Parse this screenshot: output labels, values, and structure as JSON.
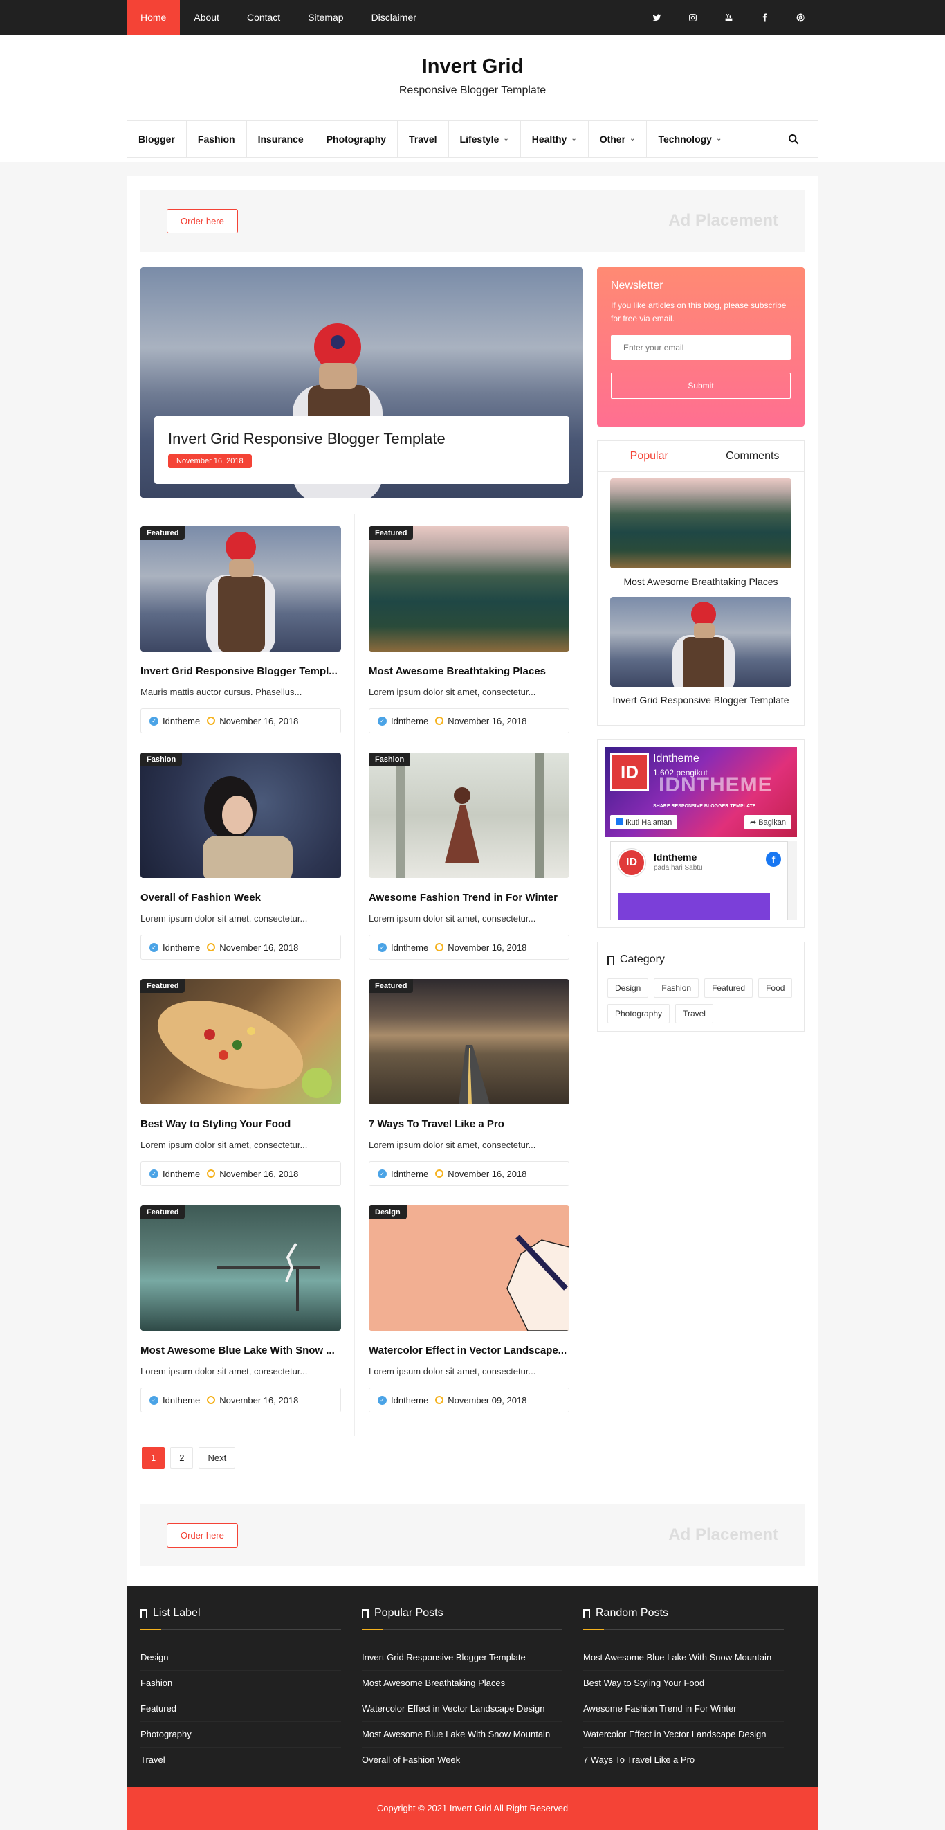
{
  "topbar": {
    "nav": [
      "Home",
      "About",
      "Contact",
      "Sitemap",
      "Disclaimer"
    ],
    "social": [
      "twitter-icon",
      "instagram-icon",
      "youtube-icon",
      "facebook-icon",
      "pinterest-icon"
    ]
  },
  "header": {
    "title": "Invert Grid",
    "subtitle": "Responsive Blogger Template"
  },
  "mainnav": {
    "items": [
      {
        "label": "Blogger",
        "dropdown": false
      },
      {
        "label": "Fashion",
        "dropdown": false
      },
      {
        "label": "Insurance",
        "dropdown": false
      },
      {
        "label": "Photography",
        "dropdown": false
      },
      {
        "label": "Travel",
        "dropdown": false
      },
      {
        "label": "Lifestyle",
        "dropdown": true
      },
      {
        "label": "Healthy",
        "dropdown": true
      },
      {
        "label": "Other",
        "dropdown": true
      },
      {
        "label": "Technology",
        "dropdown": true
      }
    ]
  },
  "ad": {
    "order_label": "Order here",
    "placement_label": "Ad Placement"
  },
  "hero": {
    "title": "Invert Grid Responsive Blogger Template",
    "date": "November 16, 2018"
  },
  "posts": [
    {
      "badge": "Featured",
      "title": "Invert Grid Responsive Blogger Templ...",
      "excerpt": "Mauris mattis auctor cursus. Phasellus...",
      "author": "Idntheme",
      "date": "November 16, 2018"
    },
    {
      "badge": "Featured",
      "title": "Most Awesome Breathtaking Places",
      "excerpt": "Lorem ipsum dolor sit amet, consectetur...",
      "author": "Idntheme",
      "date": "November 16, 2018"
    },
    {
      "badge": "Fashion",
      "title": "Overall of Fashion Week",
      "excerpt": "Lorem ipsum dolor sit amet, consectetur...",
      "author": "Idntheme",
      "date": "November 16, 2018"
    },
    {
      "badge": "Fashion",
      "title": "Awesome Fashion Trend in For Winter",
      "excerpt": "Lorem ipsum dolor sit amet, consectetur...",
      "author": "Idntheme",
      "date": "November 16, 2018"
    },
    {
      "badge": "Featured",
      "title": "Best Way to Styling Your Food",
      "excerpt": "Lorem ipsum dolor sit amet, consectetur...",
      "author": "Idntheme",
      "date": "November 16, 2018"
    },
    {
      "badge": "Featured",
      "title": "7 Ways To Travel Like a Pro",
      "excerpt": "Lorem ipsum dolor sit amet, consectetur...",
      "author": "Idntheme",
      "date": "November 16, 2018"
    },
    {
      "badge": "Featured",
      "title": "Most Awesome Blue Lake With Snow ...",
      "excerpt": "Lorem ipsum dolor sit amet, consectetur...",
      "author": "Idntheme",
      "date": "November 16, 2018"
    },
    {
      "badge": "Design",
      "title": "Watercolor Effect in Vector Landscape...",
      "excerpt": "Lorem ipsum dolor sit amet, consectetur...",
      "author": "Idntheme",
      "date": "November 09, 2018"
    }
  ],
  "pager": {
    "page1": "1",
    "page2": "2",
    "next": "Next"
  },
  "newsletter": {
    "title": "Newsletter",
    "text": "If you like articles on this blog, please subscribe for free via email.",
    "placeholder": "Enter your email",
    "submit": "Submit"
  },
  "tabs": {
    "popular": "Popular",
    "comments": "Comments",
    "items": [
      "Most Awesome Breathtaking Places",
      "Invert Grid Responsive Blogger Template"
    ]
  },
  "fb": {
    "name": "Idntheme",
    "followers": "1.602 pengikut",
    "banner_text": "IDNTHEME",
    "tagline": "SHARE RESPONSIVE BLOGGER TEMPLATE",
    "follow": "Ikuti Halaman",
    "share": "Bagikan",
    "post_name": "Idntheme",
    "post_time": "pada hari Sabtu"
  },
  "category": {
    "title": "Category",
    "items": [
      "Design",
      "Fashion",
      "Featured",
      "Food",
      "Photography",
      "Travel"
    ]
  },
  "footer": {
    "list_label": {
      "title": "List Label",
      "items": [
        "Design",
        "Fashion",
        "Featured",
        "Photography",
        "Travel"
      ]
    },
    "popular": {
      "title": "Popular Posts",
      "items": [
        "Invert Grid Responsive Blogger Template",
        "Most Awesome Breathtaking Places",
        "Watercolor Effect in Vector Landscape Design",
        "Most Awesome Blue Lake With Snow Mountain",
        "Overall of Fashion Week"
      ]
    },
    "random": {
      "title": "Random Posts",
      "items": [
        "Most Awesome Blue Lake With Snow Mountain",
        "Best Way to Styling Your Food",
        "Awesome Fashion Trend in For Winter",
        "Watercolor Effect in Vector Landscape Design",
        "7 Ways To Travel Like a Pro"
      ]
    },
    "copyright": "Copyright © 2021 Invert Grid All Right Reserved"
  },
  "colors": {
    "accent": "#f44336",
    "dark": "#212121",
    "gold": "#f5b21e"
  }
}
